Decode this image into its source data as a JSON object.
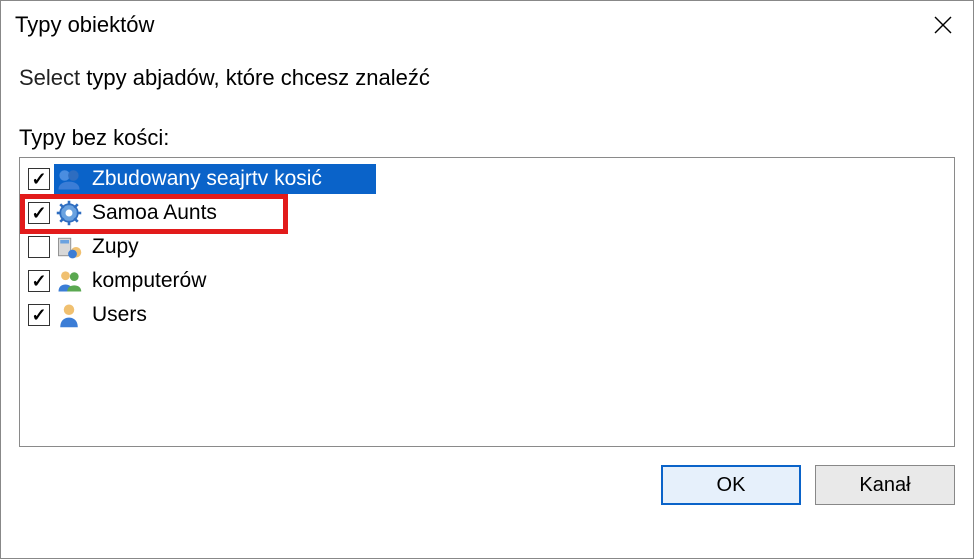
{
  "window": {
    "title": "Typy obiektów"
  },
  "instruction": {
    "lead": "Select",
    "rest": " typy abjadów, które chcesz znaleźć"
  },
  "list": {
    "label": "Typy bez kości:",
    "items": [
      {
        "label": "Zbudowany seajrtv kosić",
        "checked": true,
        "selected": true,
        "highlighted": false,
        "icon": "group-icon"
      },
      {
        "label": "Samoa Aunts",
        "checked": true,
        "selected": false,
        "highlighted": true,
        "icon": "gear-icon"
      },
      {
        "label": "Zupy",
        "checked": false,
        "selected": false,
        "highlighted": false,
        "icon": "server-group-icon"
      },
      {
        "label": "komputerów",
        "checked": true,
        "selected": false,
        "highlighted": false,
        "icon": "users-icon"
      },
      {
        "label": "Users",
        "checked": true,
        "selected": false,
        "highlighted": false,
        "icon": "user-icon"
      }
    ]
  },
  "buttons": {
    "ok": "OK",
    "cancel": "Kanał"
  }
}
